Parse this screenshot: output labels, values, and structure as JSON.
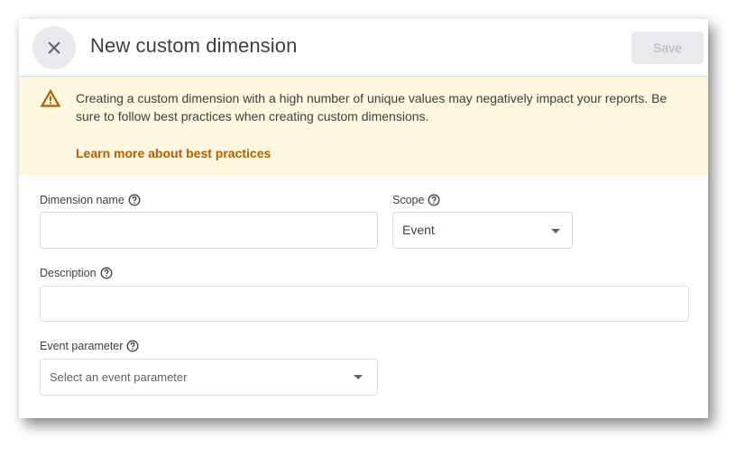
{
  "dialog": {
    "title": "New custom dimension",
    "save_label": "Save",
    "close_icon": "close-icon"
  },
  "banner": {
    "icon": "warning-icon",
    "message": "Creating a custom dimension with a high number of unique values may negatively impact your reports. Be sure to follow best practices when creating custom dimensions.",
    "link_text": "Learn more about best practices",
    "link_color": "#b06000",
    "background": "#fef7e0"
  },
  "form": {
    "dimension_name": {
      "label": "Dimension name",
      "value": "",
      "placeholder": ""
    },
    "scope": {
      "label": "Scope",
      "selected": "Event"
    },
    "description": {
      "label": "Description",
      "value": "",
      "placeholder": ""
    },
    "event_parameter": {
      "label": "Event parameter",
      "placeholder": "Select an event parameter"
    }
  }
}
